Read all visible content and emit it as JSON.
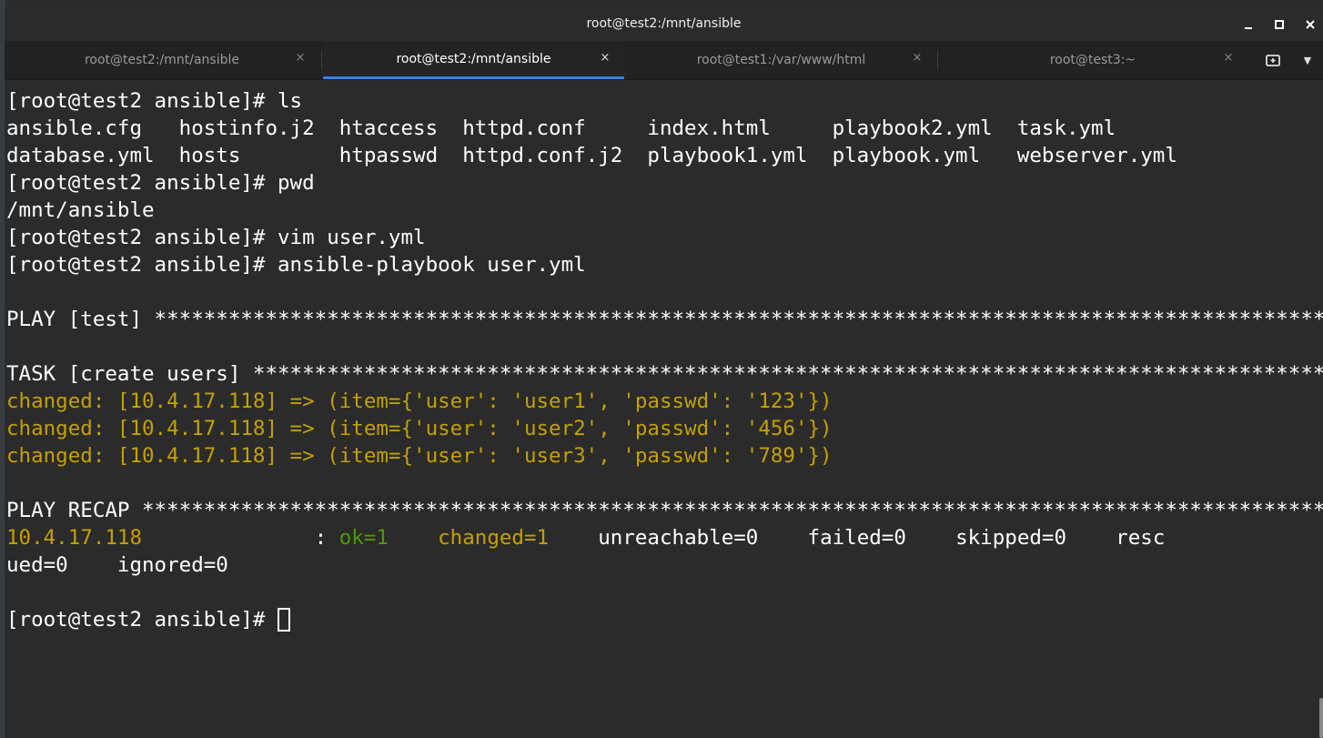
{
  "window": {
    "title": "root@test2:/mnt/ansible"
  },
  "tabs": [
    {
      "label": "root@test2:/mnt/ansible",
      "active": false
    },
    {
      "label": "root@test2:/mnt/ansible",
      "active": true
    },
    {
      "label": "root@test1:/var/www/html",
      "active": false
    },
    {
      "label": "root@test3:~",
      "active": false
    }
  ],
  "icons": {
    "tab_close": "×",
    "new_tab": "new-tab-icon",
    "tab_menu": "▼"
  },
  "colors": {
    "terminal_bg": "#2b2b2b",
    "accent": "#3584e4",
    "changed_yellow": "#c4a000",
    "ok_green": "#4e9a06"
  },
  "terminal": {
    "prompt": "[root@test2 ansible]# ",
    "cmd_ls": "ls",
    "ls_row1": "ansible.cfg   hostinfo.j2  htaccess  httpd.conf     index.html     playbook2.yml  task.yml",
    "ls_row2": "database.yml  hosts        htpasswd  httpd.conf.j2  playbook1.yml  playbook.yml   webserver.yml",
    "cmd_pwd": "pwd",
    "pwd_out": "/mnt/ansible",
    "cmd_vim": "vim user.yml",
    "cmd_playbook": "ansible-playbook user.yml",
    "play_header": "PLAY [test] **************************************************************************************************",
    "task_header": "TASK [create users] ******************************************************************************************",
    "changed_1": "changed: [10.4.17.118] => (item={'user': 'user1', 'passwd': '123'})",
    "changed_2": "changed: [10.4.17.118] => (item={'user': 'user2', 'passwd': '456'})",
    "changed_3": "changed: [10.4.17.118] => (item={'user': 'user3', 'passwd': '789'})",
    "recap_header": "PLAY RECAP ***************************************************************************************************",
    "recap_host": "10.4.17.118",
    "recap_colon": "              : ",
    "recap_ok": "ok=1",
    "recap_gap1": "    ",
    "recap_changed": "changed=1",
    "recap_rest": "    unreachable=0    failed=0    skipped=0    resc",
    "recap_wrap": "ued=0    ignored=0"
  }
}
